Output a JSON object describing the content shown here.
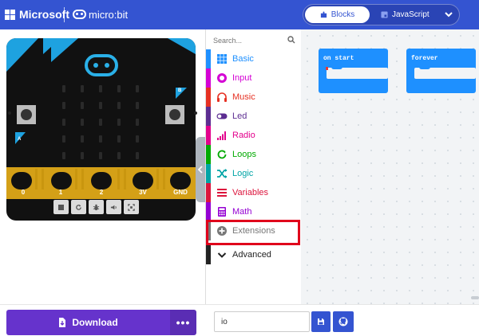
{
  "header": {
    "brand": "Microsoft",
    "product": "micro:bit",
    "tabs": [
      {
        "label": "Blocks",
        "active": true
      },
      {
        "label": "JavaScript",
        "active": false
      }
    ],
    "colors": {
      "bar": "#3454d1"
    }
  },
  "simulator": {
    "pins": [
      "0",
      "1",
      "2",
      "3V",
      "GND"
    ],
    "buttons": [
      "A",
      "B"
    ],
    "controls": [
      "stop-icon",
      "restart-icon",
      "debug-icon",
      "mute-icon",
      "fullscreen-icon"
    ]
  },
  "toolbox": {
    "search_placeholder": "Search...",
    "categories": [
      {
        "label": "Basic",
        "color": "#1e90ff",
        "icon": "grid-icon"
      },
      {
        "label": "Input",
        "color": "#d400d4",
        "icon": "target-icon"
      },
      {
        "label": "Music",
        "color": "#e63022",
        "icon": "headphones-icon"
      },
      {
        "label": "Led",
        "color": "#5c2d91",
        "icon": "toggle-icon"
      },
      {
        "label": "Radio",
        "color": "#e3008c",
        "icon": "signal-icon"
      },
      {
        "label": "Loops",
        "color": "#00aa00",
        "icon": "refresh-icon"
      },
      {
        "label": "Logic",
        "color": "#00a4a6",
        "icon": "shuffle-icon"
      },
      {
        "label": "Variables",
        "color": "#dc143c",
        "icon": "lines-icon"
      },
      {
        "label": "Math",
        "color": "#9400d3",
        "icon": "calculator-icon"
      },
      {
        "label": "Extensions",
        "color": "#777777",
        "icon": "plus-circle-icon"
      },
      {
        "label": "Advanced",
        "color": "#222222",
        "icon": "chevron-down-icon"
      }
    ]
  },
  "workspace": {
    "blocks": [
      {
        "label": "on start"
      },
      {
        "label": "forever"
      }
    ]
  },
  "footer": {
    "download_label": "Download",
    "more_label": "•••",
    "project_name": "io"
  }
}
